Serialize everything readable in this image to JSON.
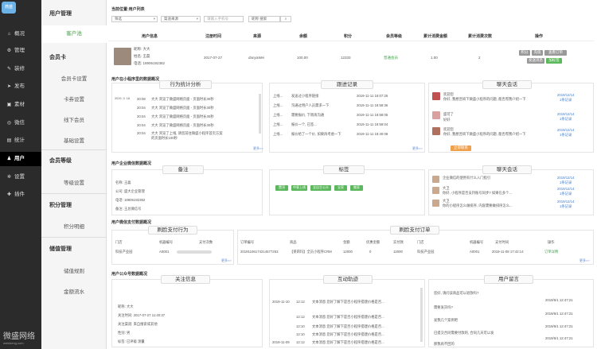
{
  "sidebar": {
    "logo_text": "微盛",
    "items": [
      "概况",
      "管理",
      "装修",
      "发布",
      "素材",
      "微信",
      "统计",
      "用户",
      "设置",
      "插件"
    ],
    "brand": "微盛网络",
    "brand_url": "weisheng.com"
  },
  "subnav": {
    "groups": [
      {
        "title": "用户管理",
        "items": [
          "客户池"
        ]
      },
      {
        "title": "会员卡",
        "items": [
          "会员卡设置",
          "卡券设置",
          "线下会员",
          "基础设置"
        ]
      },
      {
        "title": "会员等级",
        "items": [
          "等级设置"
        ]
      },
      {
        "title": "积分管理",
        "items": [
          "积分明细"
        ]
      },
      {
        "title": "储值管理",
        "items": [
          "储值规则",
          "金额流水"
        ]
      }
    ]
  },
  "page": {
    "title": "当前位置:用户列表"
  },
  "filters": {
    "f1": "筛选",
    "f2": "渠道来源",
    "f3": "请输入手机号",
    "f4": "昵称 搜索",
    "search": "搜索"
  },
  "table": {
    "headers": [
      "用户信息",
      "注册时间",
      "来源",
      "余额",
      "积分",
      "会员等级",
      "累计消费金额",
      "累计消费次数",
      "操作"
    ],
    "row": {
      "nick": "昵称: 大大",
      "name": "姓名: 王磊",
      "phone": "电话: 18906192382",
      "reg": "2017-07-27",
      "source": "danyaWei",
      "balance": "100.00",
      "points": "12333",
      "level": "普通会员",
      "total": "1.00",
      "count": "2",
      "actions": [
        "积分",
        "充值",
        "查看订单",
        "发送消息",
        "加标签"
      ]
    }
  },
  "overview": {
    "title": "用户在小程序里的数据概况"
  },
  "behavior": {
    "title": "行为统计分析",
    "rows": [
      [
        "2019. 3. 18",
        "20:08",
        "大大 浏览了微盛网络页面 - 页面时长30秒"
      ],
      [
        "",
        "20:04",
        "大大 浏览了微盛网络页面 - 页面时长30秒"
      ],
      [
        "",
        "20:04",
        "大大 浏览了微盛网络页面 - 页面时长30秒"
      ],
      [
        "",
        "20:04",
        "大大 浏览了微盛网络页面 - 页面时长30秒"
      ],
      [
        "",
        "20:04",
        "大大 浏览了上线, 请您前往微盛小程序首页方案的页面时长100秒"
      ]
    ],
    "more": "更多>>"
  },
  "followup": {
    "title": "跟进记录",
    "rows": [
      [
        "上线...",
        "发送过小程序链接",
        "2019-11-11 18:07:25"
      ],
      [
        "上线...",
        "沟通过用户人员需求一下",
        "2019-11-11 18:58:36"
      ],
      [
        "上线...",
        "需要报价, 下周再沟通",
        "2019-11-11 18:58:05"
      ],
      [
        "上线...",
        "报价一个, 已签...",
        "2019-11-11 18:59:04"
      ],
      [
        "上线...",
        "报价给了一个价, 如果再考虑一下",
        "2019-11-11 18:40:08"
      ]
    ],
    "more": "更多>>"
  },
  "chat1": {
    "title": "聊天会话",
    "rows": [
      [
        "欢迎您",
        "你好, 我想咨询下微盛小程序的问题, 能否帮我介绍一下",
        "2019/12/14",
        "1条记录"
      ],
      [
        "盛可了",
        "好好",
        "2019/12/14",
        "1条记录"
      ],
      [
        "欢迎您",
        "你好, 我想咨询下微盛小程序的问题, 能否帮我介绍一下",
        "2019/12/14",
        "1条记录"
      ]
    ],
    "btn": "立即联系"
  },
  "enterprise": {
    "title": "用户企业微信数据概况"
  },
  "note": {
    "title": "备注",
    "name": "名称: 王磊",
    "company": "公司: 盛大企业管理",
    "phone": "电话: 18906192382",
    "remark": "备注: 王总微信号"
  },
  "tags": {
    "title": "标签",
    "items": [
      "置顶",
      "中意上线",
      "全自主公众",
      "全家",
      "搬家"
    ]
  },
  "chat2": {
    "title": "聊天会话",
    "rows": [
      [
        "大卫",
        "企业微信的使用有什么入门指引",
        "2019/12/14",
        "1条记录"
      ],
      [
        "大卫",
        "你好, 小程序是否支持账号同步? 如果在多个...",
        "2019/12/14",
        "1条记录"
      ],
      [
        "大卫",
        "你的小程序怎么做排序, 内容需要做排序怎么...",
        "2019/12/14",
        "1条记录"
      ]
    ]
  },
  "payment": {
    "title": "用户微信支付数据概况"
  },
  "payBehavior": {
    "title": "刷脸支付行为",
    "headers": [
      "门店",
      "机器编号",
      "支付次数"
    ],
    "row": [
      "科技产业园",
      "A0001"
    ],
    "more": "更多>>"
  },
  "payOrders": {
    "title": "刷脸支付订单",
    "headers": [
      "订单编号",
      "商品",
      "金额",
      "优惠金额",
      "实付款",
      "门店",
      "机器编号",
      "支付时间",
      "操作"
    ],
    "row": [
      "20191106174214577253",
      "【莱莉玛】全员小程序CRM",
      "12000",
      "0",
      "12000",
      "科技产业园",
      "A0001",
      "2019-11-08 17:42:14",
      "订单详情"
    ],
    "more": "更多>>"
  },
  "wechat": {
    "title": "用户公众号数据概况"
  },
  "follow": {
    "title": "关注信息",
    "rows": [
      "昵称: 大大",
      "关注时间: 2017-07-27 11:40:37",
      "关注渠道: 来自搜索或其他",
      "性别: 男",
      "标签: 已评级 测量"
    ]
  },
  "interaction": {
    "title": "互动轨迹",
    "rows": [
      [
        "2019-11-10",
        "12:12",
        "文本消息 您好了解下是否小程序搭建价格是否...",
        "文本消息 您好了解下是否小程序"
      ],
      [
        "",
        "12:12",
        "文本消息 您好了解下是否小程序搭建价格是否..."
      ],
      [
        "",
        "12:10",
        "文本消息 您好了解下是否小程序搭建价格是否..."
      ],
      [
        "",
        "12:10",
        "文本消息 您好了解下是否小程序搭建价格是否..."
      ],
      [
        "2019-11-09",
        "12:12",
        "文本消息 您好了解下是否小程序搭建价格是否..."
      ]
    ],
    "more": "更多>>"
  },
  "messages": {
    "title": "用户留言",
    "rows": [
      [
        "您好, 请问该商品可以退款吗?",
        "2019/6/1 12:47:21"
      ],
      [
        "需要发货吗?",
        "2019/6/1 12:47:21"
      ],
      [
        "发我几个案例吧",
        "2019/6/1 12:47:21"
      ],
      [
        "已提交合同需要付款的, 合同几天可以发",
        "2019/6/1 12:47:21"
      ],
      [
        "那我再不回的",
        "2019/6/1 12:47:21"
      ]
    ]
  }
}
